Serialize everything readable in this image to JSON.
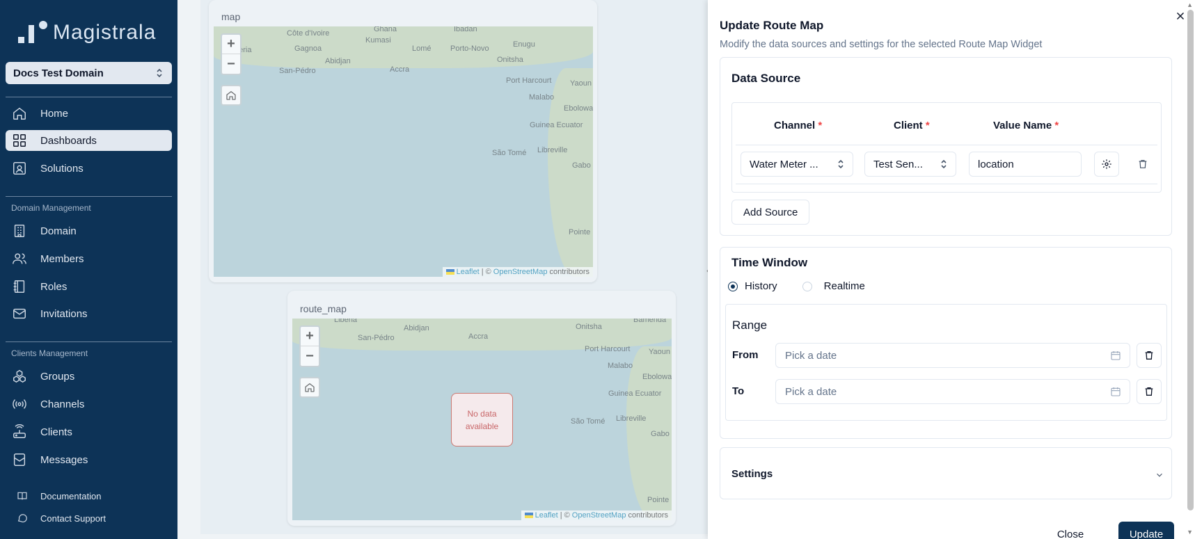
{
  "sidebar": {
    "logo_text": "Magistrala",
    "domain_select": "Docs Test Domain",
    "items": [
      {
        "label": "Home"
      },
      {
        "label": "Dashboards"
      },
      {
        "label": "Solutions"
      }
    ],
    "domain_section": "Domain Management",
    "domain_items": [
      {
        "label": "Domain"
      },
      {
        "label": "Members"
      },
      {
        "label": "Roles"
      },
      {
        "label": "Invitations"
      }
    ],
    "clients_section": "Clients Management",
    "clients_items": [
      {
        "label": "Groups"
      },
      {
        "label": "Channels"
      },
      {
        "label": "Clients"
      },
      {
        "label": "Messages"
      }
    ],
    "footer_items": [
      {
        "label": "Documentation"
      },
      {
        "label": "Contact Support"
      }
    ]
  },
  "widgets": {
    "map": {
      "title": "map",
      "labels": [
        "Côte d'Ivoire",
        "Ghana",
        "Ibadan",
        "Enugu",
        "Kumasi",
        "Lomé",
        "Porto-Novo",
        "Onitsha",
        "Gagnoa",
        "Abidjan",
        "Accra",
        "San-Pédro",
        "Port Harcourt",
        "Yaoun",
        "Malabo",
        "Ebolowa",
        "Guinea Ecuator",
        "São Tomé",
        "Libreville",
        "Gabo",
        "Pointe",
        "beria"
      ]
    },
    "route_map": {
      "title": "route_map",
      "no_data": "No data available",
      "labels": [
        "Liberia",
        "San-Pédro",
        "Abidjan",
        "Accra",
        "Onitsha",
        "Bamenda",
        "Port Harcourt",
        "Yaoun",
        "Malabo",
        "Ebolowa",
        "Guinea Ecuator",
        "São Tomé",
        "Libreville",
        "Gabo",
        "Pointe"
      ]
    },
    "zoom_in": "+",
    "zoom_out": "−",
    "attribution": {
      "leaflet": "Leaflet",
      "sep": "| ©",
      "osm": "OpenStreetMap",
      "suffix": "contributors"
    }
  },
  "panel": {
    "title": "Update Route Map",
    "description": "Modify the data sources and settings for the selected Route Map Widget",
    "data_source": {
      "title": "Data Source",
      "columns": {
        "channel": "Channel",
        "client": "Client",
        "value_name": "Value Name",
        "required_mark": "*"
      },
      "row": {
        "channel": "Water Meter ...",
        "client": "Test Sen...",
        "value_name": "location"
      },
      "add_source": "Add Source"
    },
    "time_window": {
      "title": "Time Window",
      "options": {
        "history": "History",
        "realtime": "Realtime"
      },
      "selected": "History",
      "range": {
        "title": "Range",
        "from_label": "From",
        "to_label": "To",
        "from_placeholder": "Pick a date",
        "to_placeholder": "Pick a date"
      }
    },
    "settings": {
      "title": "Settings"
    },
    "close_label": "Close",
    "update_label": "Update"
  },
  "colors": {
    "sidebar_bg": "#0d3357",
    "accent": "#0d3357",
    "required": "#ef4444",
    "no_data": "#b91c1c"
  }
}
